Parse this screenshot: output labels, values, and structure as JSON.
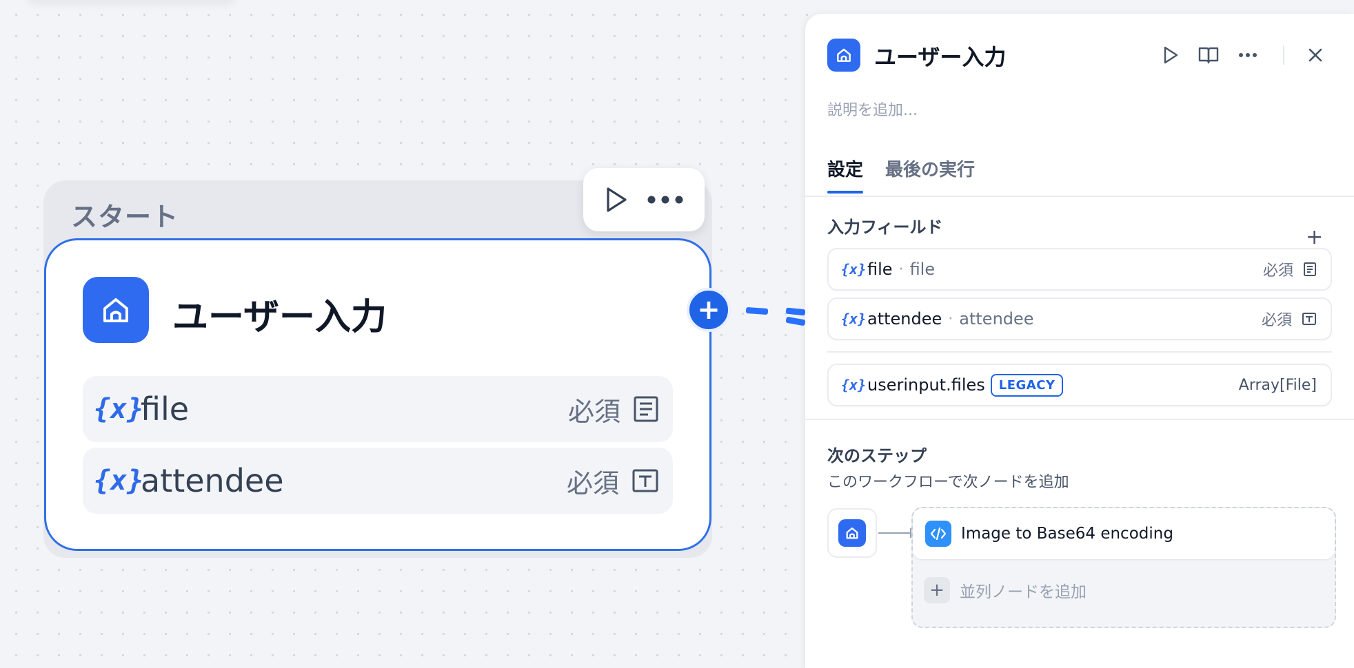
{
  "canvas": {
    "start_group_label": "スタート",
    "node": {
      "title": "ユーザー入力",
      "fields": [
        {
          "var_icon": "{x}",
          "name": "file",
          "required": "必須",
          "icon": "paragraph-icon"
        },
        {
          "var_icon": "{x}",
          "name": "attendee",
          "required": "必須",
          "icon": "text-input-icon"
        }
      ],
      "add_handle": "+"
    }
  },
  "panel": {
    "title": "ユーザー入力",
    "description_placeholder": "説明を追加...",
    "tabs": [
      {
        "label": "設定",
        "active": true
      },
      {
        "label": "最後の実行",
        "active": false
      }
    ],
    "input_fields_title": "入力フィールド",
    "input_fields_add": "+",
    "fields": [
      {
        "var_icon": "{x}",
        "name": "file",
        "sep": "·",
        "sub": "file",
        "required": "必須",
        "icon": "paragraph-icon"
      },
      {
        "var_icon": "{x}",
        "name": "attendee",
        "sep": "·",
        "sub": "attendee",
        "required": "必須",
        "icon": "text-input-icon"
      }
    ],
    "system_field": {
      "var_icon": "{x}",
      "name": "userinput.files",
      "badge": "LEGACY",
      "type": "Array[File]"
    },
    "next_step": {
      "title": "次のステップ",
      "subtitle": "このワークフローで次ノードを追加",
      "node_label": "Image to Base64 encoding",
      "add_parallel_icon": "+",
      "add_parallel": "並列ノードを追加"
    }
  },
  "colors": {
    "accent": "#1f64e6",
    "node_icon_bg": "#2f6bf0",
    "code_icon_bg": "#2e90fa",
    "canvas_bg": "#f2f4f7"
  }
}
